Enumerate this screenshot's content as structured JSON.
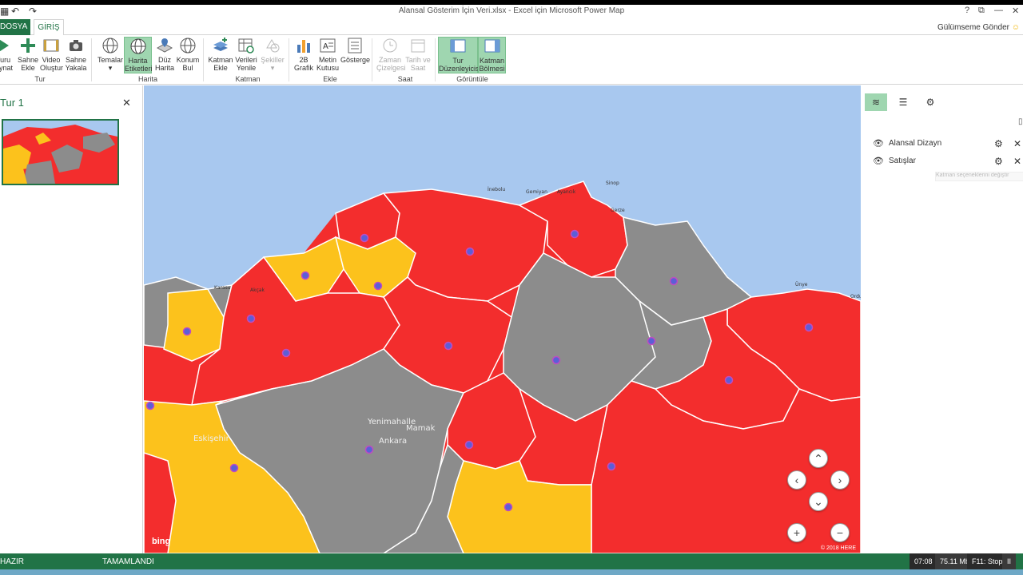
{
  "window": {
    "title": "Alansal Gösterim İçin Veri.xlsx - Excel için Microsoft Power Map",
    "help": "?",
    "restore": "⧉",
    "minimize": "—",
    "close": "✕"
  },
  "tabs": {
    "file": "DOSYA",
    "home": "GİRİŞ",
    "feedback": "Gülümseme Gönder"
  },
  "ribbon": {
    "play_tour": "Turu\nOynat",
    "new_scene": "Sahne\nEkle",
    "create_video": "Video\nOluştur",
    "capture_scene": "Sahne\nYakala",
    "themes": "Temalar",
    "map_labels": "Harita\nEtiketleri",
    "flat_map": "Düz\nHarita",
    "find_location": "Konum\nBul",
    "add_layer": "Katman\nEkle",
    "refresh_data": "Verileri\nYenile",
    "shapes": "Şekiller",
    "chart_2d": "2B\nGrafik",
    "text_box": "Metin\nKutusu",
    "legend": "Gösterge",
    "timeline": "Zaman\nÇizelgesi",
    "date_time": "Tarih ve\nSaat",
    "tour_editor": "Tur\nDüzenleyicisi",
    "layer_pane": "Katman\nBölmesi",
    "group_tour": "Tur",
    "group_map": "Harita",
    "group_layer": "Katman",
    "group_insert": "Ekle",
    "group_time": "Saat",
    "group_view": "Görüntüle"
  },
  "tour": {
    "title": "Tur 1",
    "close": "✕"
  },
  "map": {
    "attribution": "bing",
    "copyright": "© 2018 HERE",
    "colors": {
      "sea": "#a8c8ef",
      "red": "#f32d2d",
      "gray": "#8c8c8c",
      "yellow": "#fcc21c",
      "border": "#ffffff"
    },
    "labels": [
      {
        "text": "İnebolu",
        "key": "inebolu"
      },
      {
        "text": "Gemiyan",
        "key": "gemiyan"
      },
      {
        "text": "Ayancık",
        "key": "ayancik"
      },
      {
        "text": "Sinop",
        "key": "sinop"
      },
      {
        "text": "Gerze",
        "key": "gerze"
      },
      {
        "text": "Karasu",
        "key": "karasu"
      },
      {
        "text": "Akçak",
        "key": "akcak"
      },
      {
        "text": "Ünye",
        "key": "unye"
      },
      {
        "text": "Ordu",
        "key": "ordu"
      },
      {
        "text": "Yenimahalle",
        "key": "yenimahalle"
      },
      {
        "text": "Ankara",
        "key": "ankara"
      },
      {
        "text": "Mamak",
        "key": "mamak"
      },
      {
        "text": "Eskişehir",
        "key": "eskisehir"
      }
    ],
    "nav": {
      "up": "⌃",
      "left": "‹",
      "right": "›",
      "down": "⌄",
      "zoom_in": "+",
      "zoom_out": "−"
    }
  },
  "layers": {
    "items": [
      {
        "name": "Alansal Dizayn"
      },
      {
        "name": "Satışlar"
      }
    ],
    "tooltip": "Katman seçeneklerini değiştir"
  },
  "status": {
    "ready": "HAZIR",
    "done": "TAMAMLANDI",
    "rec_time": "07:08",
    "rec_size": "75.11 Mb",
    "rec_stop": "F11: Stop",
    "rec_pause": "II"
  }
}
